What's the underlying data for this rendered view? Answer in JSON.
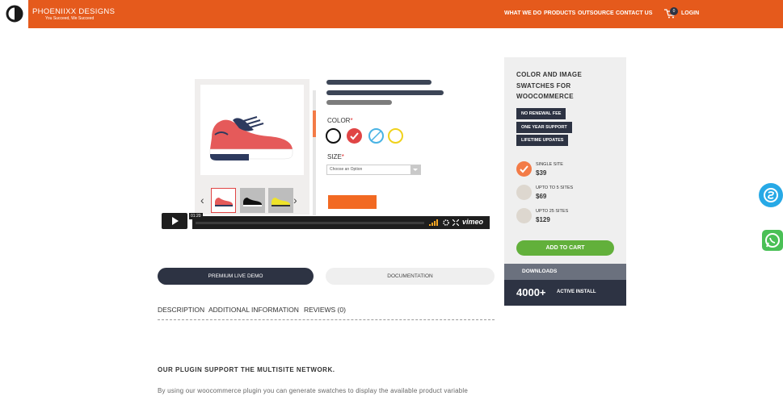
{
  "header": {
    "brand": "PHOENIIXX DESIGNS",
    "tagline": "You Succeed, We Succeed",
    "nav": [
      "WHAT WE DO",
      "PRODUCTS",
      "OUTSOURCE",
      "CONTACT US",
      "LOGIN"
    ],
    "cart_count": "0",
    "accent_color": "#e55a1c"
  },
  "mockup": {
    "color_label": "COLOR",
    "size_label": "SIZE",
    "required_mark": "*",
    "select_placeholder": "Choose an Option"
  },
  "video": {
    "time": "01:20",
    "provider": "vimeo",
    "progress": 0
  },
  "actions": {
    "demo_label": "PREMIUM LIVE DEMO",
    "docs_label": "DOCUMENTATION"
  },
  "tabs": [
    "DESCRIPTION",
    "ADDITIONAL INFORMATION",
    "REVIEWS (0)"
  ],
  "content": {
    "heading": "OUR PLUGIN SUPPORT THE MULTISITE NETWORK.",
    "paragraph": "By using our woocommerce plugin you can generate swatches to display the available product variable"
  },
  "sidebar": {
    "title": "COLOR AND IMAGE SWATCHES FOR WOOCOMMERCE",
    "badges": [
      "NO RENEWAL FEE",
      "ONE YEAR SUPPORT",
      "LIFETIME UPDATES"
    ],
    "plans": [
      {
        "name": "SINGLE SITE",
        "price": "$39",
        "selected": true
      },
      {
        "name": "UPTO TO 5 SITES",
        "price": "$69",
        "selected": false
      },
      {
        "name": "UPTO 25 SITES",
        "price": "$129",
        "selected": false
      }
    ],
    "add_to_cart": "ADD TO CART",
    "downloads": "DOWNLOADS",
    "install_count": "4000+",
    "install_label": "ACTIVE INSTALL"
  }
}
